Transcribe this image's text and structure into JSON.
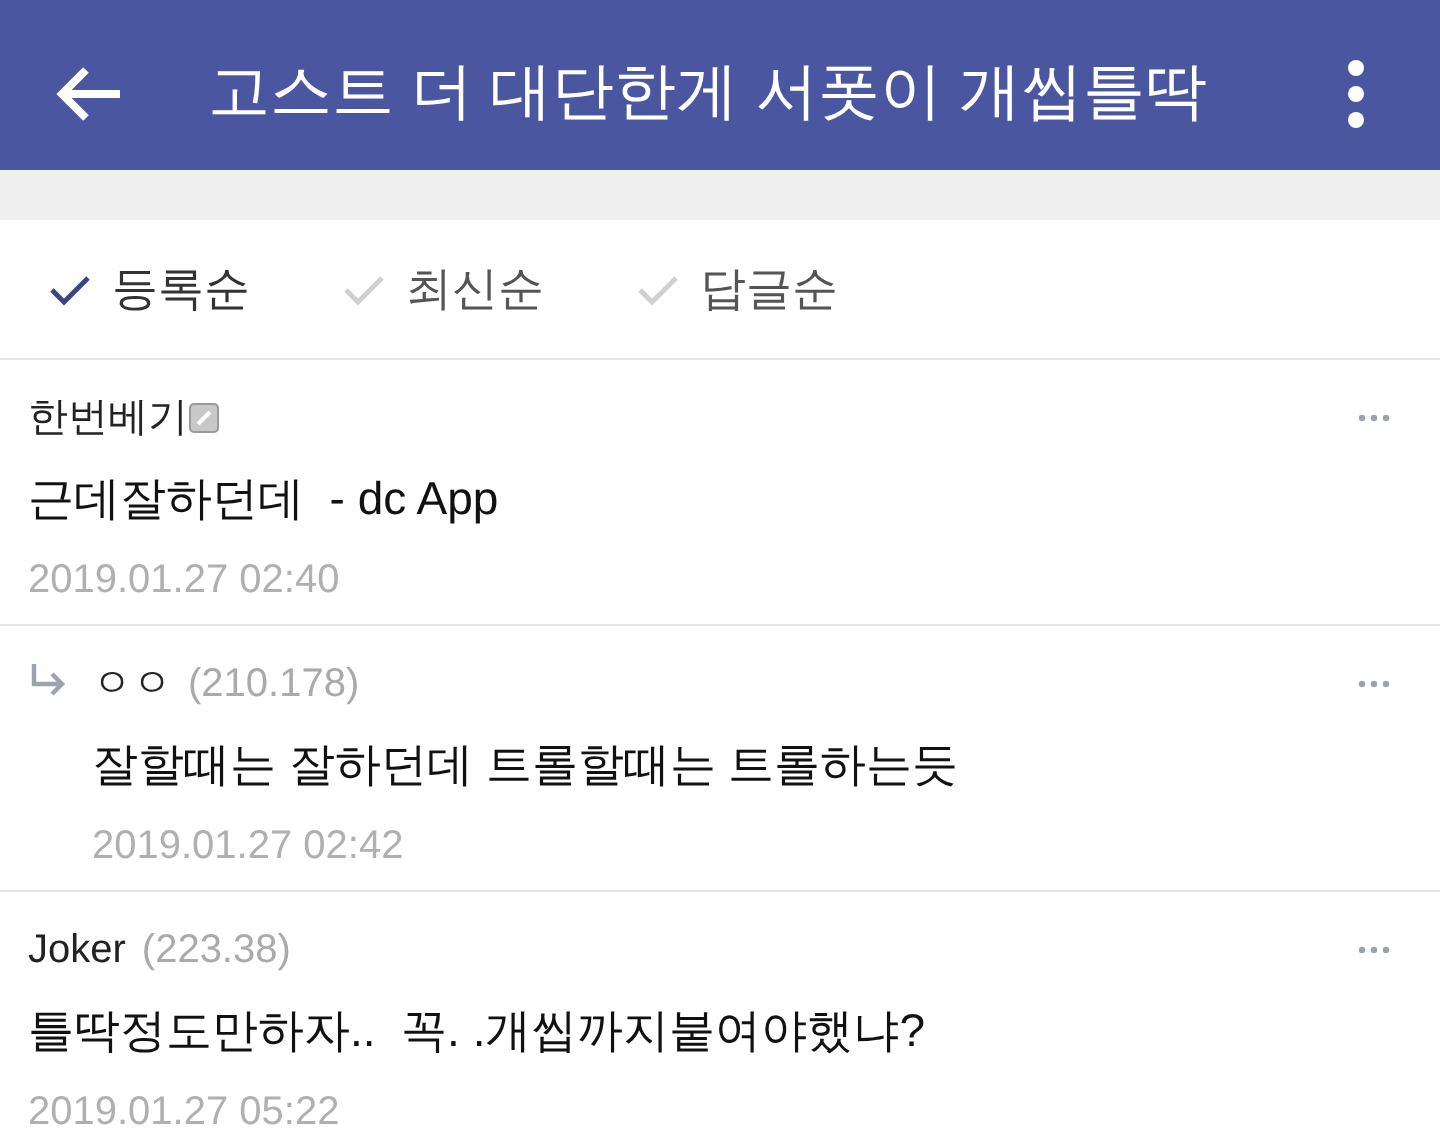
{
  "header": {
    "title": "고스트 더 대단한게 서폿이 개씹틀딱"
  },
  "sort_options": [
    {
      "label": "등록순",
      "selected": true
    },
    {
      "label": "최신순",
      "selected": false
    },
    {
      "label": "답글순",
      "selected": false
    }
  ],
  "comments": [
    {
      "kind": "comment",
      "author": "한번베기",
      "badge": true,
      "text": "근데잘하던데  - dc App",
      "time": "2019.01.27 02:40"
    },
    {
      "kind": "reply",
      "author": "ㅇㅇ",
      "ip": "(210.178)",
      "badge": false,
      "text": "잘할때는 잘하던데 트롤할때는 트롤하는듯",
      "time": "2019.01.27 02:42"
    },
    {
      "kind": "comment",
      "author": "Joker",
      "ip": "(223.38)",
      "badge": false,
      "text": "틀딱정도만하자..  꼭. .개씹까지붙여야했냐?",
      "time": "2019.01.27 05:22"
    }
  ]
}
